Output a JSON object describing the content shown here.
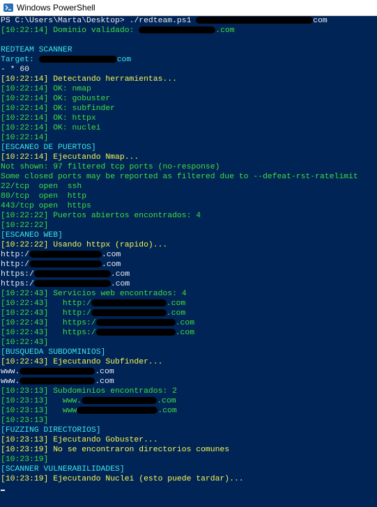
{
  "window": {
    "title": "Windows PowerShell"
  },
  "colors": {
    "background": "#012456",
    "gray": "#eeedf0",
    "green": "#3fe03f",
    "yellow": "#f8f854",
    "cyan": "#3ee6e6",
    "redaction": "#000000"
  },
  "console": {
    "lines": [
      {
        "color": "gray",
        "segments": [
          "PS C:\\Users\\Marta\\Desktop> ./redteam.ps1 ",
          {
            "w": 168
          },
          "com"
        ]
      },
      {
        "color": "green",
        "segments": [
          "[10:22:14] Dominio validado: ",
          {
            "w": 110
          },
          ".com"
        ]
      },
      {
        "color": "gray",
        "segments": [
          ""
        ]
      },
      {
        "color": "cyan",
        "segments": [
          "REDTEAM SCANNER"
        ]
      },
      {
        "color": "cyan",
        "segments": [
          "Target: ",
          {
            "w": 112
          },
          "com"
        ]
      },
      {
        "color": "gray",
        "segments": [
          "- * 60"
        ]
      },
      {
        "color": "yellow",
        "segments": [
          "[10:22:14] Detectando herramientas..."
        ]
      },
      {
        "color": "green",
        "segments": [
          "[10:22:14] OK: nmap"
        ]
      },
      {
        "color": "green",
        "segments": [
          "[10:22:14] OK: gobuster"
        ]
      },
      {
        "color": "green",
        "segments": [
          "[10:22:14] OK: subfinder"
        ]
      },
      {
        "color": "green",
        "segments": [
          "[10:22:14] OK: httpx"
        ]
      },
      {
        "color": "green",
        "segments": [
          "[10:22:14] OK: nuclei"
        ]
      },
      {
        "color": "green",
        "segments": [
          "[10:22:14]"
        ]
      },
      {
        "color": "cyan",
        "segments": [
          "[ESCANEO DE PUERTOS]"
        ]
      },
      {
        "color": "yellow",
        "segments": [
          "[10:22:14] Ejecutando Nmap..."
        ]
      },
      {
        "color": "green",
        "segments": [
          "Not shown: 97 filtered tcp ports (no-response)"
        ]
      },
      {
        "color": "green",
        "segments": [
          "Some closed ports may be reported as filtered due to --defeat-rst-ratelimit"
        ]
      },
      {
        "color": "green",
        "segments": [
          "22/tcp  open  ssh"
        ]
      },
      {
        "color": "green",
        "segments": [
          "80/tcp  open  http"
        ]
      },
      {
        "color": "green",
        "segments": [
          "443/tcp open  https"
        ]
      },
      {
        "color": "green",
        "segments": [
          "[10:22:22] Puertos abiertos encontrados: 4"
        ]
      },
      {
        "color": "green",
        "segments": [
          "[10:22:22]"
        ]
      },
      {
        "color": "cyan",
        "segments": [
          "[ESCANEO WEB]"
        ]
      },
      {
        "color": "yellow",
        "segments": [
          "[10:22:22] Usando httpx (rapido)..."
        ]
      },
      {
        "color": "gray",
        "segments": [
          "http:/",
          {
            "w": 104
          },
          ".com"
        ]
      },
      {
        "color": "gray",
        "segments": [
          "http:/",
          {
            "w": 104
          },
          ".com"
        ]
      },
      {
        "color": "gray",
        "segments": [
          "https:/",
          {
            "w": 110
          },
          ".com"
        ]
      },
      {
        "color": "gray",
        "segments": [
          "https:/",
          {
            "w": 110
          },
          ".com"
        ]
      },
      {
        "color": "green",
        "segments": [
          "[10:22:43] Servicios web encontrados: 4"
        ]
      },
      {
        "color": "green",
        "segments": [
          "[10:22:43]   http:/",
          {
            "w": 108
          },
          ".com"
        ]
      },
      {
        "color": "green",
        "segments": [
          "[10:22:43]   http:/",
          {
            "w": 108
          },
          ".com"
        ]
      },
      {
        "color": "green",
        "segments": [
          "[10:22:43]   https:/",
          {
            "w": 114
          },
          ".com"
        ]
      },
      {
        "color": "green",
        "segments": [
          "[10:22:43]   https:/",
          {
            "w": 114
          },
          ".com"
        ]
      },
      {
        "color": "green",
        "segments": [
          "[10:22:43]"
        ]
      },
      {
        "color": "cyan",
        "segments": [
          "[BUSQUEDA SUBDOMINIOS]"
        ]
      },
      {
        "color": "yellow",
        "segments": [
          "[10:22:43] Ejecutando Subfinder..."
        ]
      },
      {
        "color": "gray",
        "segments": [
          "www.",
          {
            "w": 108
          },
          ".com"
        ]
      },
      {
        "color": "gray",
        "segments": [
          "www.",
          {
            "w": 108
          },
          ".com"
        ]
      },
      {
        "color": "green",
        "segments": [
          "[10:23:13] Subdominios encontrados: 2"
        ]
      },
      {
        "color": "green",
        "segments": [
          "[10:23:13]   www.",
          {
            "w": 108
          },
          ".com"
        ]
      },
      {
        "color": "green",
        "segments": [
          "[10:23:13]   www",
          {
            "w": 116
          },
          ".com"
        ]
      },
      {
        "color": "green",
        "segments": [
          "[10:23:13]"
        ]
      },
      {
        "color": "cyan",
        "segments": [
          "[FUZZING DIRECTORIOS]"
        ]
      },
      {
        "color": "yellow",
        "segments": [
          "[10:23:13] Ejecutando Gobuster..."
        ]
      },
      {
        "color": "yellow",
        "segments": [
          "[10:23:19] No se encontraron directorios comunes"
        ]
      },
      {
        "color": "green",
        "segments": [
          "[10:23:19]"
        ]
      },
      {
        "color": "cyan",
        "segments": [
          "[SCANNER VULNERABILIDADES]"
        ]
      },
      {
        "color": "yellow",
        "segments": [
          "[10:23:19] Ejecutando Nuclei (esto puede tardar)..."
        ]
      }
    ]
  }
}
